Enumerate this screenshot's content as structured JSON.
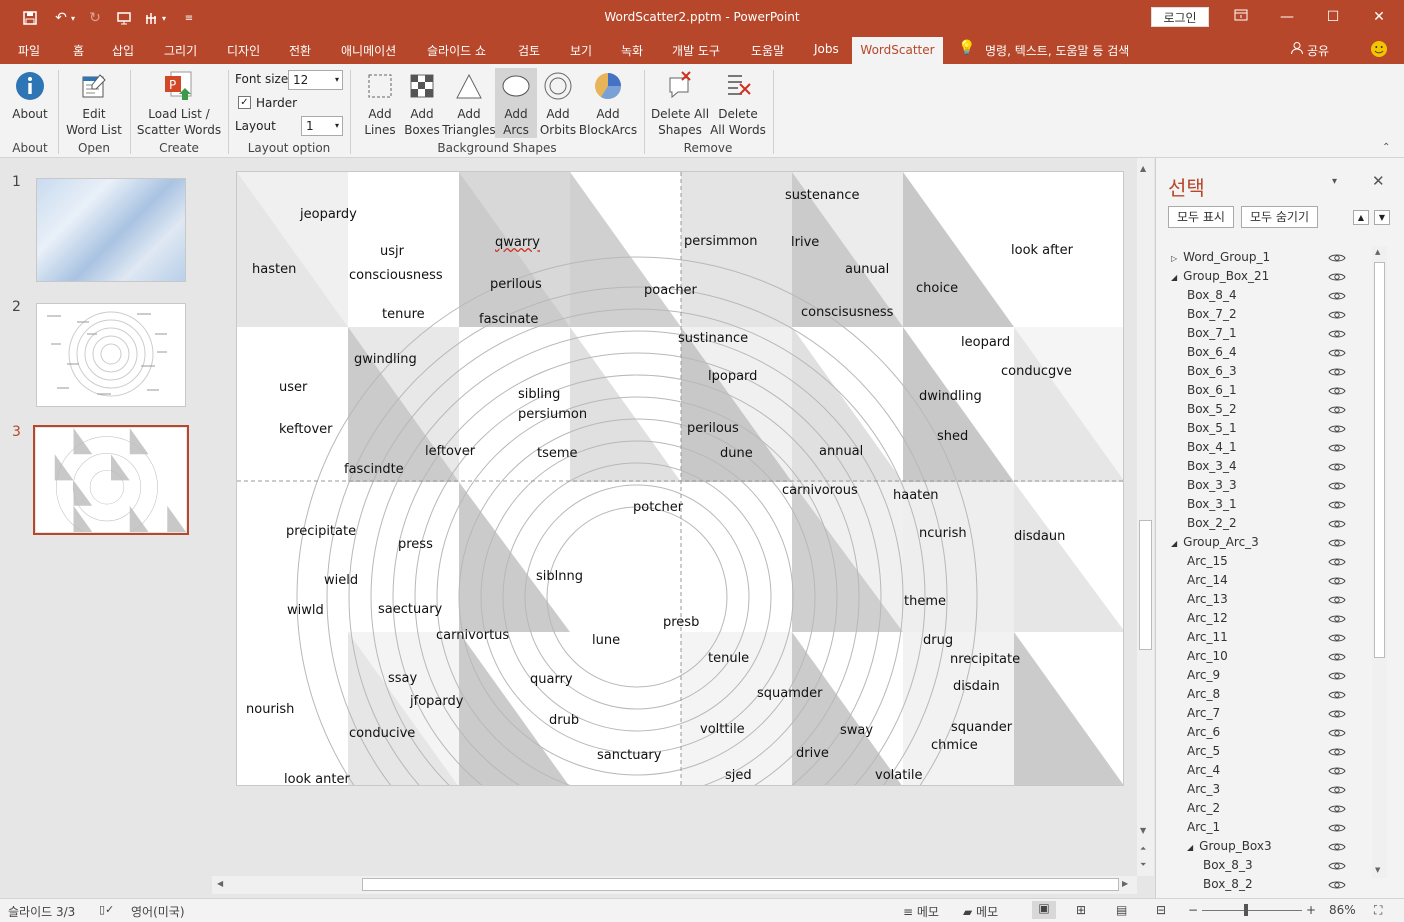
{
  "app": {
    "title": "WordScatter2.pptm  -  PowerPoint",
    "login_label": "로그인",
    "accent": "#b7472a"
  },
  "tabs": [
    "파일",
    "홈",
    "삽입",
    "그리기",
    "디자인",
    "전환",
    "애니메이션",
    "슬라이드 쇼",
    "검토",
    "보기",
    "녹화",
    "개발 도구",
    "도움말",
    "Jobs"
  ],
  "active_tab": "WordScatter",
  "tell_me": "명령, 텍스트, 도움말 등 검색",
  "share_label": "공유",
  "ribbon": {
    "about": {
      "label": "About",
      "group": "About"
    },
    "edit_word_list": {
      "line1": "Edit",
      "line2": "Word List",
      "group": "Open"
    },
    "load_list": {
      "line1": "Load List /",
      "line2": "Scatter Words",
      "group": "Create"
    },
    "font_size_label": "Font size",
    "font_size_value": "12",
    "harder_label": "Harder",
    "layout_label": "Layout",
    "layout_value": "1",
    "layout_group": "Layout option",
    "add_lines": {
      "line1": "Add",
      "line2": "Lines"
    },
    "add_boxes": {
      "line1": "Add",
      "line2": "Boxes"
    },
    "add_triangles": {
      "line1": "Add",
      "line2": "Triangles"
    },
    "add_arcs": {
      "line1": "Add",
      "line2": "Arcs"
    },
    "add_orbits": {
      "line1": "Add",
      "line2": "Orbits"
    },
    "add_blockarcs": {
      "line1": "Add",
      "line2": "BlockArcs"
    },
    "background_group": "Background Shapes",
    "delete_all_shapes": {
      "line1": "Delete All",
      "line2": "Shapes"
    },
    "delete_all_words": {
      "line1": "Delete",
      "line2": "All Words"
    },
    "remove_group": "Remove"
  },
  "thumbnails": [
    "1",
    "2",
    "3"
  ],
  "slide_words": [
    "jeopardy",
    "usjr",
    "hasten",
    "consciousness",
    "tenure",
    "qwarry",
    "perilous",
    "fascinate",
    "persimmon",
    "poacher",
    "sustenance",
    "lrive",
    "aunual",
    "conscisusness",
    "choice",
    "look after",
    "sustinance",
    "gwindling",
    "user",
    "keftover",
    "leftover",
    "fascindte",
    "sibling",
    "persiumon",
    "tseme",
    "lpopard",
    "perilous",
    "dune",
    "annual",
    "leopard",
    "conducgve",
    "dwindling",
    "shed",
    "carnivorous",
    "haaten",
    "potcher",
    "ncurish",
    "disdaun",
    "precipitate",
    "press",
    "wield",
    "siblnng",
    "wiwld",
    "saectuary",
    "carnivortus",
    "lune",
    "presb",
    "theme",
    "drug",
    "nrecipitate",
    "tenule",
    "ssay",
    "quarry",
    "jfopardy",
    "squamder",
    "disdain",
    "nourish",
    "drub",
    "volttile",
    "sway",
    "squander",
    "chmice",
    "conducive",
    "sanctuary",
    "drive",
    "look anter",
    "sjed",
    "volatile"
  ],
  "selection_pane": {
    "title": "선택",
    "show_all": "모두 표시",
    "hide_all": "모두 숨기기",
    "items": [
      "Word_Group_1",
      "Group_Box_21",
      "Box_8_4",
      "Box_7_2",
      "Box_7_1",
      "Box_6_4",
      "Box_6_3",
      "Box_6_1",
      "Box_5_2",
      "Box_5_1",
      "Box_4_1",
      "Box_3_4",
      "Box_3_3",
      "Box_3_1",
      "Box_2_2",
      "Group_Arc_3",
      "Arc_15",
      "Arc_14",
      "Arc_13",
      "Arc_12",
      "Arc_11",
      "Arc_10",
      "Arc_9",
      "Arc_8",
      "Arc_7",
      "Arc_6",
      "Arc_5",
      "Arc_4",
      "Arc_3",
      "Arc_2",
      "Arc_1",
      "Group_Box3",
      "Box_8_3",
      "Box_8_2"
    ]
  },
  "status": {
    "slide": "슬라이드 3/3",
    "language": "영어(미국)",
    "notes": "메모",
    "comments": "메모",
    "zoom": "86%"
  }
}
